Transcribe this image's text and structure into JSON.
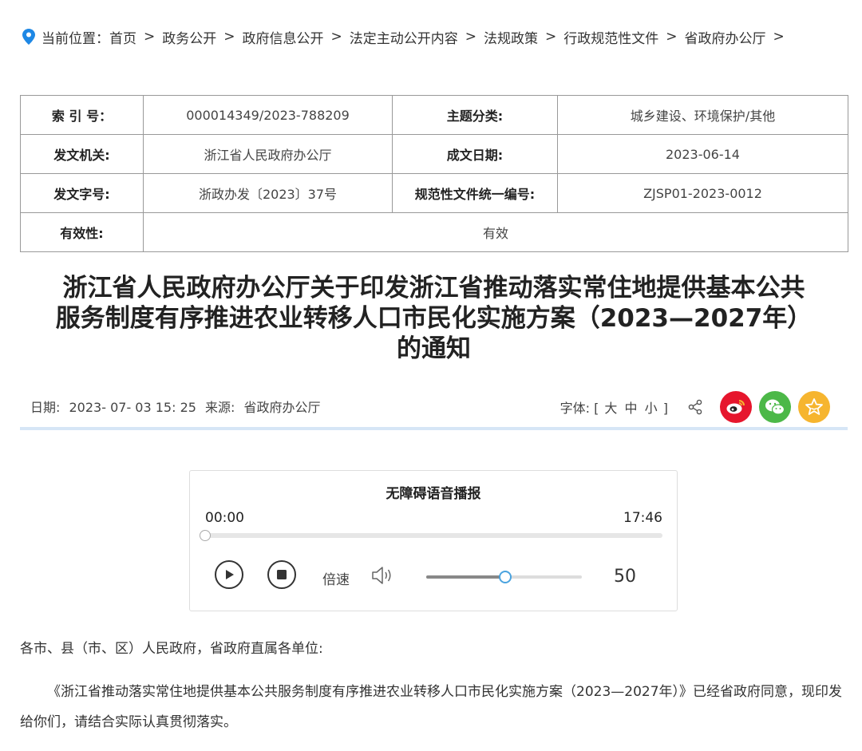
{
  "breadcrumb": {
    "prefix": "当前位置：",
    "items": [
      "首页",
      "政务公开",
      "政府信息公开",
      "法定主动公开内容",
      "法规政策",
      "行政规范性文件",
      "省政府办公厅"
    ]
  },
  "meta_table": {
    "index_label": "索 引 号：",
    "index_value": "000014349/2023-788209",
    "topic_label": "主题分类:",
    "topic_value": "城乡建设、环境保护/其他",
    "issuer_label": "发文机关:",
    "issuer_value": "浙江省人民政府办公厅",
    "date_label": "成文日期:",
    "date_value": "2023-06-14",
    "docno_label": "发文字号:",
    "docno_value": "浙政办发〔2023〕37号",
    "unified_label": "规范性文件统一编号:",
    "unified_value": "ZJSP01-2023-0012",
    "validity_label": "有效性:",
    "validity_value": "有效"
  },
  "title_lines": [
    "浙江省人民政府办公厅关于印发浙江省推动落实常住地提供基本公共",
    "服务制度有序推进农业转移人口市民化实施方案（2023—2027年）",
    "的通知"
  ],
  "info": {
    "date_label": "日期:",
    "date_value": "2023- 07- 03 15: 25",
    "source_label": "来源:",
    "source_value": "省政府办公厅"
  },
  "font_size": {
    "label": "字体:",
    "open": "[",
    "large": "大",
    "medium": "中",
    "small": "小",
    "close": "]"
  },
  "share_icons": [
    "share-icon",
    "weibo-icon",
    "wechat-icon",
    "favorite-icon"
  ],
  "colors": {
    "weibo": "#e6162d",
    "wechat": "#4cb848",
    "favorite": "#f6b52f",
    "divider": "#d6e6f6",
    "accent": "#1e88e5"
  },
  "player": {
    "title": "无障碍语音播报",
    "current_time": "00:00",
    "total_time": "17:46",
    "progress": 0,
    "speed_label": "倍速",
    "volume": 50,
    "volume_display": "50"
  },
  "body": {
    "greeting": "各市、县（市、区）人民政府，省政府直属各单位:",
    "paragraph": "《浙江省推动落实常住地提供基本公共服务制度有序推进农业转移人口市民化实施方案（2023—2027年）》已经省政府同意，现印发给你们，请结合实际认真贯彻落实。"
  }
}
